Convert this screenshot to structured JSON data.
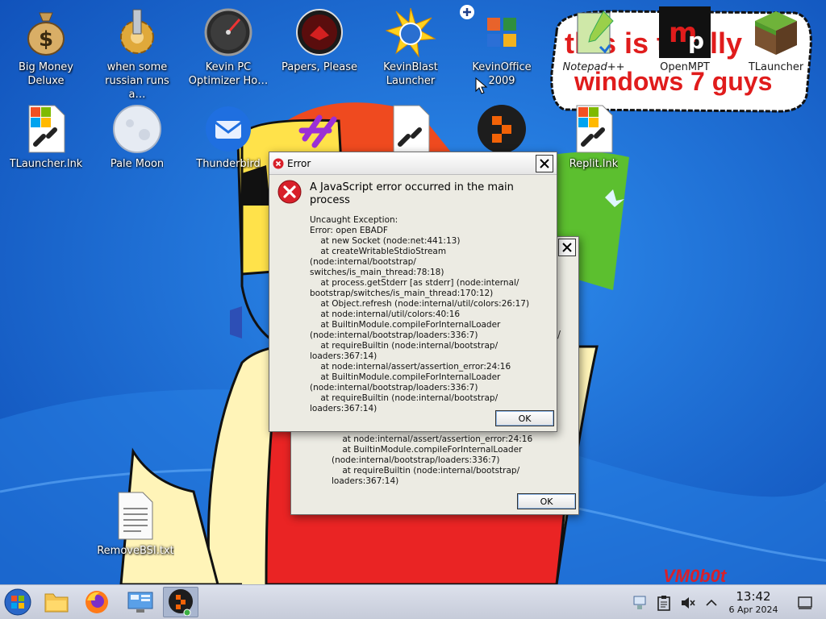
{
  "desktop": {
    "icons": [
      {
        "label": "Big Money\nDeluxe",
        "icon": "money-bag-icon"
      },
      {
        "label": "when some\nrussian runs a…",
        "icon": "gears-icon"
      },
      {
        "label": "Kevin PC\nOptimizer Ho…",
        "icon": "speedometer-icon"
      },
      {
        "label": "Papers, Please",
        "icon": "papers-please-icon"
      },
      {
        "label": "KevinBlast\nLauncher",
        "icon": "starburst-icon"
      },
      {
        "label": "KevinOffice\n2009",
        "icon": "office-logo-icon"
      },
      {
        "label": "Notepad++",
        "icon": "notepad-plus-icon"
      },
      {
        "label": "OpenMPT",
        "icon": "openmpt-icon"
      },
      {
        "label": "TLauncher",
        "icon": "grass-block-icon"
      },
      {
        "label": "TLauncher.lnk",
        "icon": "shortcut-file-icon"
      },
      {
        "label": "Pale Moon",
        "icon": "pale-moon-icon"
      },
      {
        "label": "Thunderbird",
        "icon": "thunderbird-icon"
      },
      {
        "label": "Replit.lnk",
        "icon": "shortcut-file-icon"
      },
      {
        "label": "RemoveBSI.txt",
        "icon": "text-file-icon"
      }
    ],
    "wallpaper_text_top": "this is totally",
    "wallpaper_text_bottom": "windows 7 guys",
    "wallpaper_signature": "VM0b0t"
  },
  "dialogs": {
    "front": {
      "title": "Error",
      "headline": "A JavaScript error occurred in the main process",
      "detail": "Uncaught Exception:\nError: open EBADF\n    at new Socket (node:net:441:13)\n    at createWritableStdioStream (node:internal/bootstrap/\nswitches/is_main_thread:78:18)\n    at process.getStderr [as stderr] (node:internal/\nbootstrap/switches/is_main_thread:170:12)\n    at Object.refresh (node:internal/util/colors:26:17)\n    at node:internal/util/colors:40:16\n    at BuiltinModule.compileForInternalLoader\n(node:internal/bootstrap/loaders:336:7)\n    at requireBuiltin (node:internal/bootstrap/\nloaders:367:14)\n    at node:internal/assert/assertion_error:24:16\n    at BuiltinModule.compileForInternalLoader\n(node:internal/bootstrap/loaders:336:7)\n    at requireBuiltin (node:internal/bootstrap/\nloaders:367:14)",
      "ok_label": "OK"
    },
    "back": {
      "detail_visible": "    at node:internal/assert/assertion_error:24:16\n    at BuiltinModule.compileForInternalLoader\n(node:internal/bootstrap/loaders:336:7)\n    at requireBuiltin (node:internal/bootstrap/\nloaders:367:14)",
      "ok_label": "OK"
    }
  },
  "taskbar": {
    "buttons": [
      {
        "icon": "start-orb-icon"
      },
      {
        "icon": "file-explorer-icon"
      },
      {
        "icon": "firefox-icon"
      },
      {
        "icon": "control-panel-icon"
      },
      {
        "icon": "replit-app-icon",
        "active": true
      }
    ],
    "tray_icons": [
      "network-icon",
      "clipboard-icon",
      "volume-muted-icon",
      "chevron-up-icon"
    ],
    "time": "13:42",
    "date": "6 Apr 2024"
  },
  "colors": {
    "desktop_blue": "#1e6fd6",
    "error_red": "#d8202a",
    "taskbar": "#d0d5e2",
    "dialog_bg": "#ecebe3"
  }
}
